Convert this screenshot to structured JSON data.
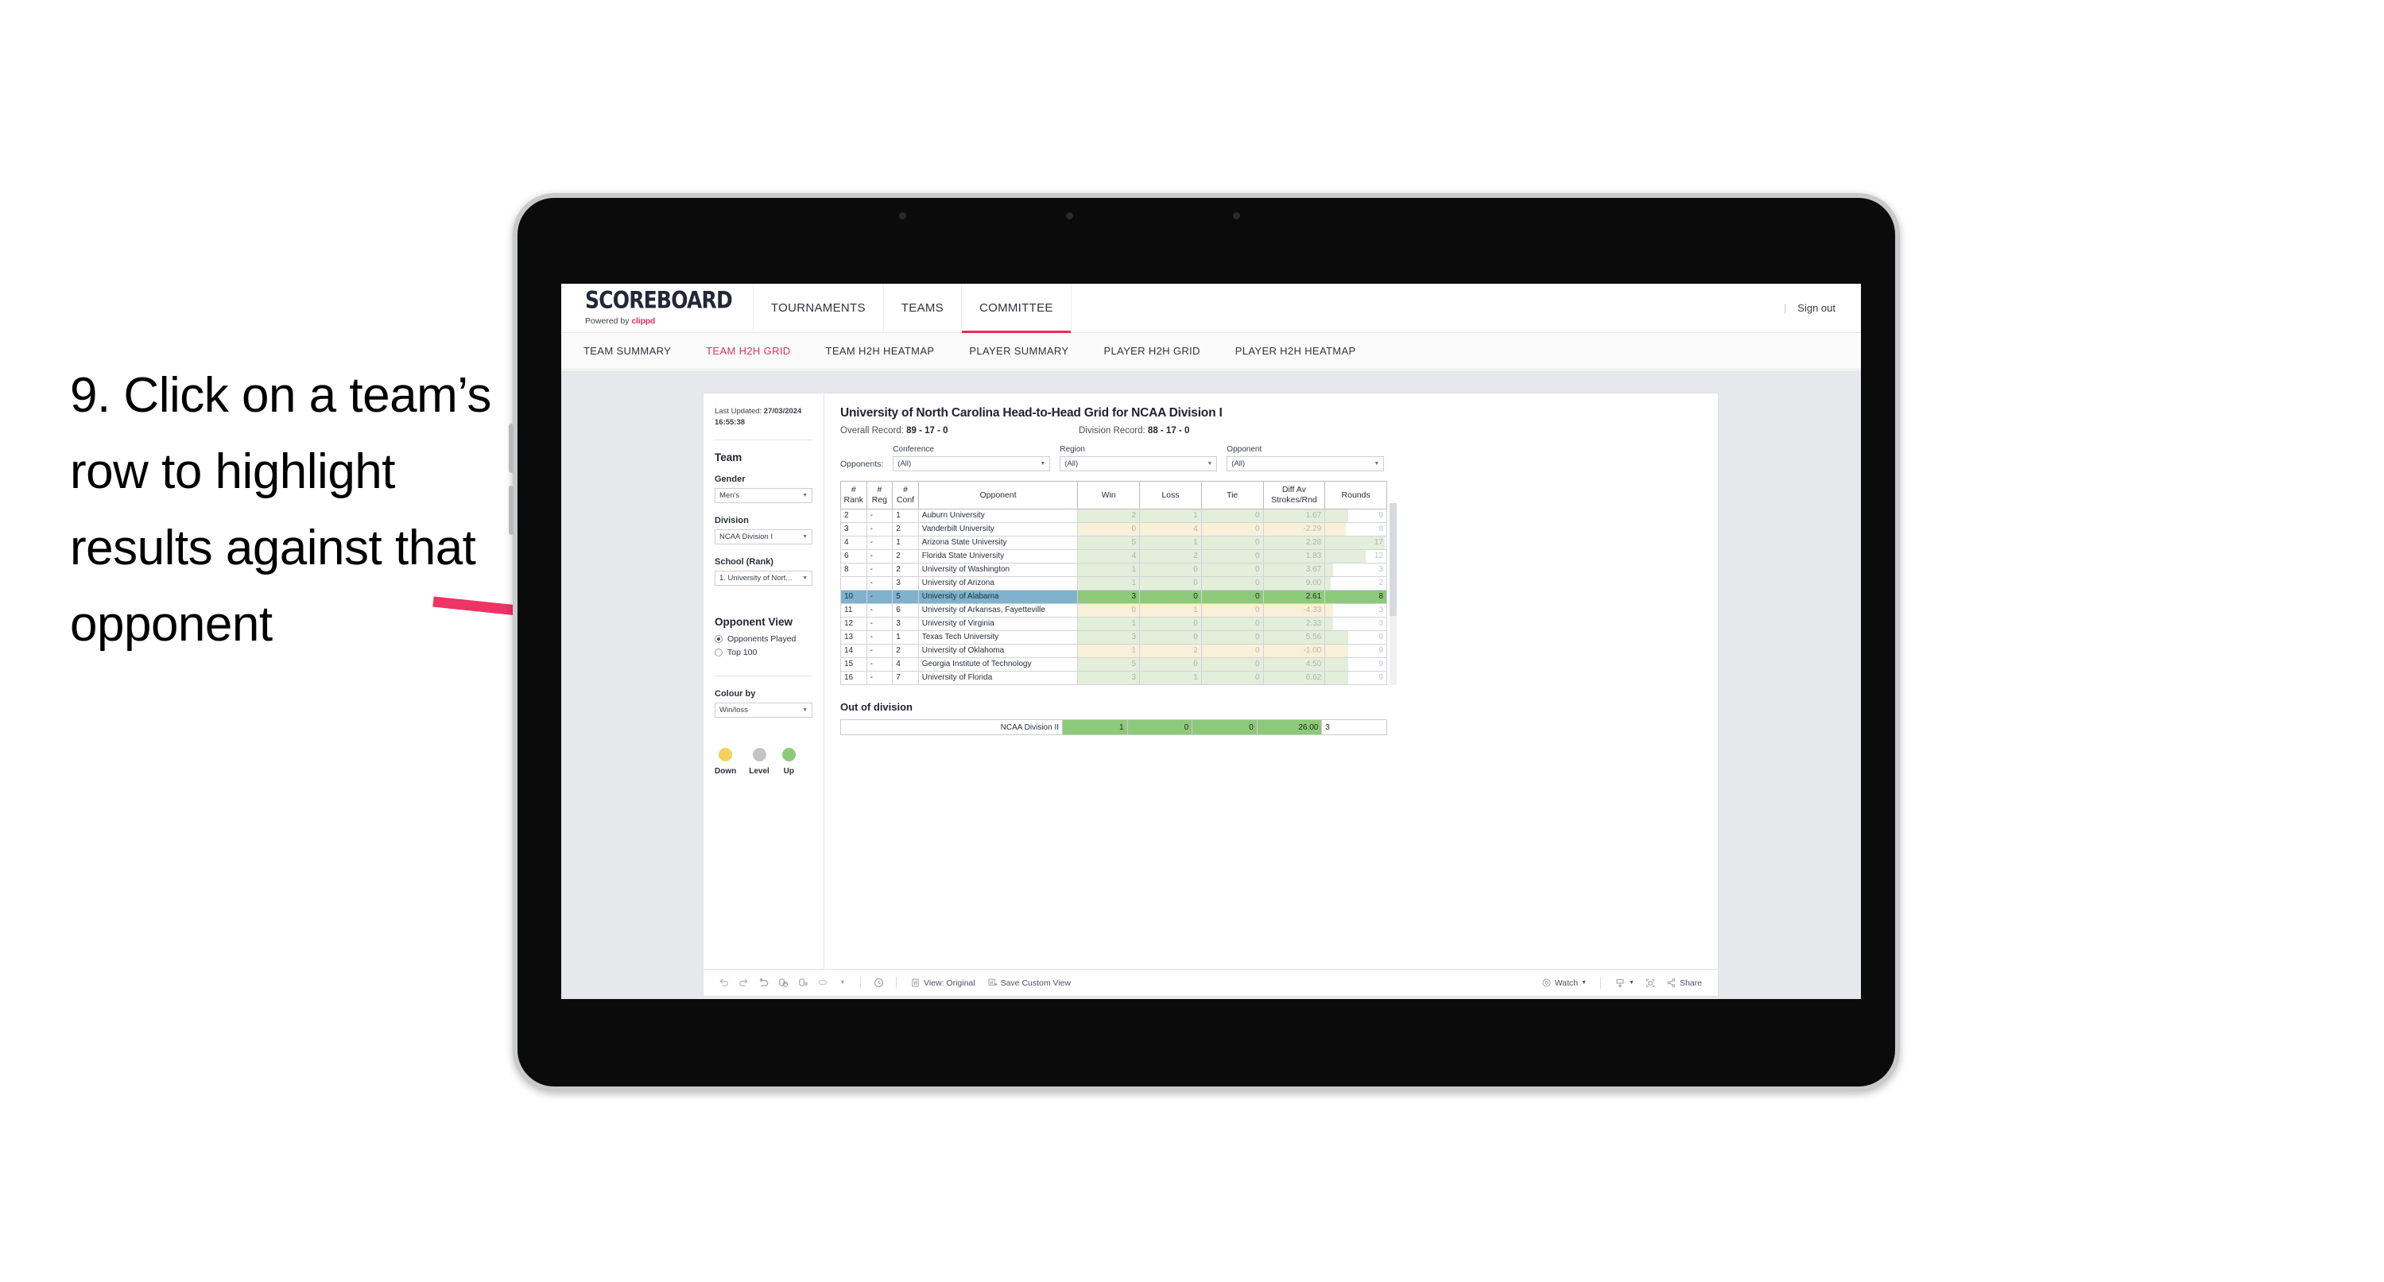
{
  "annotation": {
    "text": "9. Click on a team’s row to highlight results against that opponent",
    "arrow_color": "#ee3365"
  },
  "topnav": {
    "logo": "SCOREBOARD",
    "powered_by_prefix": "Powered by ",
    "powered_by_brand": "clippd",
    "tabs": [
      {
        "label": "TOURNAMENTS",
        "active": false
      },
      {
        "label": "TEAMS",
        "active": false
      },
      {
        "label": "COMMITTEE",
        "active": true
      }
    ],
    "divider": "|",
    "sign_out": "Sign out"
  },
  "subnav": {
    "tabs": [
      {
        "label": "TEAM SUMMARY",
        "active": false
      },
      {
        "label": "TEAM H2H GRID",
        "active": true
      },
      {
        "label": "TEAM H2H HEATMAP",
        "active": false
      },
      {
        "label": "PLAYER SUMMARY",
        "active": false
      },
      {
        "label": "PLAYER H2H GRID",
        "active": false
      },
      {
        "label": "PLAYER H2H HEATMAP",
        "active": false
      }
    ]
  },
  "sidebar": {
    "last_updated_label": "Last Updated: ",
    "last_updated_value": "27/03/2024 16:55:38",
    "team_heading": "Team",
    "gender_label": "Gender",
    "gender_value": "Men’s",
    "division_label": "Division",
    "division_value": "NCAA Division I",
    "school_label": "School (Rank)",
    "school_value": "1. University of Nort...",
    "opponent_view_heading": "Opponent View",
    "opponent_view_options": [
      {
        "label": "Opponents Played",
        "selected": true
      },
      {
        "label": "Top 100",
        "selected": false
      }
    ],
    "colour_by_label": "Colour by",
    "colour_by_value": "Win/loss",
    "legend": [
      {
        "label": "Down",
        "color": "#f2d25c"
      },
      {
        "label": "Level",
        "color": "#c4c4c4"
      },
      {
        "label": "Up",
        "color": "#8dc97a"
      }
    ]
  },
  "main": {
    "title": "University of North Carolina Head-to-Head Grid for NCAA Division I",
    "overall_record_label": "Overall Record: ",
    "overall_record_value": "89 - 17 - 0",
    "division_record_label": "Division Record: ",
    "division_record_value": "88 - 17 - 0",
    "opponents_label": "Opponents:",
    "filters": [
      {
        "label": "Conference",
        "value": "(All)"
      },
      {
        "label": "Region",
        "value": "(All)"
      },
      {
        "label": "Opponent",
        "value": "(All)"
      }
    ],
    "columns": [
      "# Rank",
      "# Reg",
      "# Conf",
      "Opponent",
      "Win",
      "Loss",
      "Tie",
      "Diff Av Strokes/Rnd",
      "Rounds"
    ],
    "column_lines": [
      [
        "#",
        "Rank"
      ],
      [
        "#",
        "Reg"
      ],
      [
        "#",
        "Conf"
      ],
      [
        "Opponent"
      ],
      [
        "Win"
      ],
      [
        "Loss"
      ],
      [
        "Tie"
      ],
      [
        "Diff Av",
        "Strokes/Rnd"
      ],
      [
        "Rounds"
      ]
    ],
    "rows": [
      {
        "rank": "2",
        "reg": "-",
        "conf": "1",
        "opponent": "Auburn University",
        "win": "2",
        "loss": "1",
        "tie": "0",
        "diff": "1.67",
        "rounds": "9",
        "tone": "up",
        "selected": false,
        "rounds_fill": 0.38
      },
      {
        "rank": "3",
        "reg": "-",
        "conf": "2",
        "opponent": "Vanderbilt University",
        "win": "0",
        "loss": "4",
        "tie": "0",
        "diff": "-2.29",
        "rounds": "8",
        "tone": "down",
        "selected": false,
        "rounds_fill": 0.34
      },
      {
        "rank": "4",
        "reg": "-",
        "conf": "1",
        "opponent": "Arizona State University",
        "win": "5",
        "loss": "1",
        "tie": "0",
        "diff": "2.28",
        "rounds": "17",
        "tone": "up",
        "selected": false,
        "rounds_fill": 0.97
      },
      {
        "rank": "6",
        "reg": "-",
        "conf": "2",
        "opponent": "Florida State University",
        "win": "4",
        "loss": "2",
        "tie": "0",
        "diff": "1.83",
        "rounds": "12",
        "tone": "up",
        "selected": false,
        "rounds_fill": 0.66
      },
      {
        "rank": "8",
        "reg": "-",
        "conf": "2",
        "opponent": "University of Washington",
        "win": "1",
        "loss": "0",
        "tie": "0",
        "diff": "3.67",
        "rounds": "3",
        "tone": "up",
        "selected": false,
        "rounds_fill": 0.13
      },
      {
        "rank": "",
        "reg": "-",
        "conf": "3",
        "opponent": "University of Arizona",
        "win": "1",
        "loss": "0",
        "tie": "0",
        "diff": "9.00",
        "rounds": "2",
        "tone": "up",
        "selected": false,
        "rounds_fill": 0.09
      },
      {
        "rank": "10",
        "reg": "-",
        "conf": "5",
        "opponent": "University of Alabama",
        "win": "3",
        "loss": "0",
        "tie": "0",
        "diff": "2.61",
        "rounds": "8",
        "tone": "up",
        "selected": true,
        "rounds_fill": 0.34
      },
      {
        "rank": "11",
        "reg": "-",
        "conf": "6",
        "opponent": "University of Arkansas, Fayetteville",
        "win": "0",
        "loss": "1",
        "tie": "0",
        "diff": "-4.33",
        "rounds": "3",
        "tone": "down",
        "selected": false,
        "rounds_fill": 0.13
      },
      {
        "rank": "12",
        "reg": "-",
        "conf": "3",
        "opponent": "University of Virginia",
        "win": "1",
        "loss": "0",
        "tie": "0",
        "diff": "2.33",
        "rounds": "3",
        "tone": "up",
        "selected": false,
        "rounds_fill": 0.13
      },
      {
        "rank": "13",
        "reg": "-",
        "conf": "1",
        "opponent": "Texas Tech University",
        "win": "3",
        "loss": "0",
        "tie": "0",
        "diff": "5.56",
        "rounds": "9",
        "tone": "up",
        "selected": false,
        "rounds_fill": 0.38
      },
      {
        "rank": "14",
        "reg": "-",
        "conf": "2",
        "opponent": "University of Oklahoma",
        "win": "1",
        "loss": "2",
        "tie": "0",
        "diff": "-1.00",
        "rounds": "9",
        "tone": "down",
        "selected": false,
        "rounds_fill": 0.38
      },
      {
        "rank": "15",
        "reg": "-",
        "conf": "4",
        "opponent": "Georgia Institute of Technology",
        "win": "5",
        "loss": "0",
        "tie": "0",
        "diff": "4.50",
        "rounds": "9",
        "tone": "up",
        "selected": false,
        "rounds_fill": 0.38
      },
      {
        "rank": "16",
        "reg": "-",
        "conf": "7",
        "opponent": "University of Florida",
        "win": "3",
        "loss": "1",
        "tie": "0",
        "diff": "6.62",
        "rounds": "9",
        "tone": "up",
        "selected": false,
        "rounds_fill": 0.38
      }
    ],
    "out_of_division_title": "Out of division",
    "out_of_division_row": {
      "label": "NCAA Division II",
      "win": "1",
      "loss": "0",
      "tie": "0",
      "diff": "26.00",
      "rounds": "3"
    }
  },
  "toolbar": {
    "icons": [
      "undo-icon",
      "redo-icon",
      "revert-icon",
      "refresh-icon",
      "pause-icon",
      "swap-icon",
      "chevron-down-icon",
      "clock-icon"
    ],
    "view_label": "View: Original",
    "save_custom_view_label": "Save Custom View",
    "watch_label": "Watch",
    "share_label": "Share"
  },
  "colors": {
    "accent": "#e0315b",
    "selected_row": "#7fb2cc",
    "green": "#8dc97a",
    "green_pale": "#e3eedb",
    "yellow_pale": "#f8f0d9"
  }
}
